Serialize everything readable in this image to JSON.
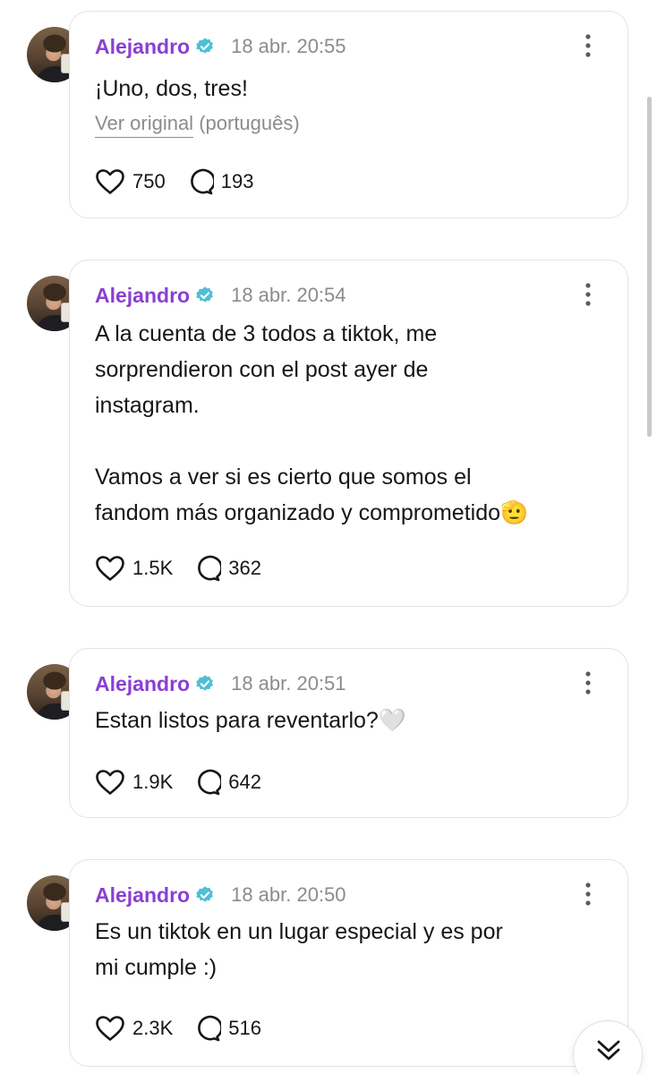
{
  "posts": [
    {
      "author": "Alejandro",
      "time": "18 abr. 20:55",
      "text": "¡Uno, dos, tres!",
      "translation": {
        "link": "Ver original",
        "language": " (português)"
      },
      "likes": "750",
      "replies": "193"
    },
    {
      "author": "Alejandro",
      "time": "18 abr. 20:54",
      "text": "A la cuenta de 3 todos a tiktok, me\nsorprendieron con el post ayer de\ninstagram.\n\nVamos a ver si es cierto que somos el\nfandom más organizado y comprometido🫡",
      "likes": "1.5K",
      "replies": "362"
    },
    {
      "author": "Alejandro",
      "time": "18 abr. 20:51",
      "text": "Estan listos para reventarlo?🤍",
      "likes": "1.9K",
      "replies": "642"
    },
    {
      "author": "Alejandro",
      "time": "18 abr. 20:50",
      "text": "Es un tiktok en un lugar especial y es por\nmi cumple :)",
      "likes": "2.3K",
      "replies": "516"
    }
  ],
  "icons": {
    "verified": "verified-badge-icon",
    "more": "more-vertical-icon",
    "like": "heart-icon",
    "reply": "speech-bubble-icon",
    "scroll": "chevron-double-down-icon"
  },
  "colors": {
    "author": "#8a3fd1",
    "verified": "#4cc0d6",
    "muted": "#8b8b90",
    "text": "#161618",
    "border": "#e3e3e6"
  }
}
